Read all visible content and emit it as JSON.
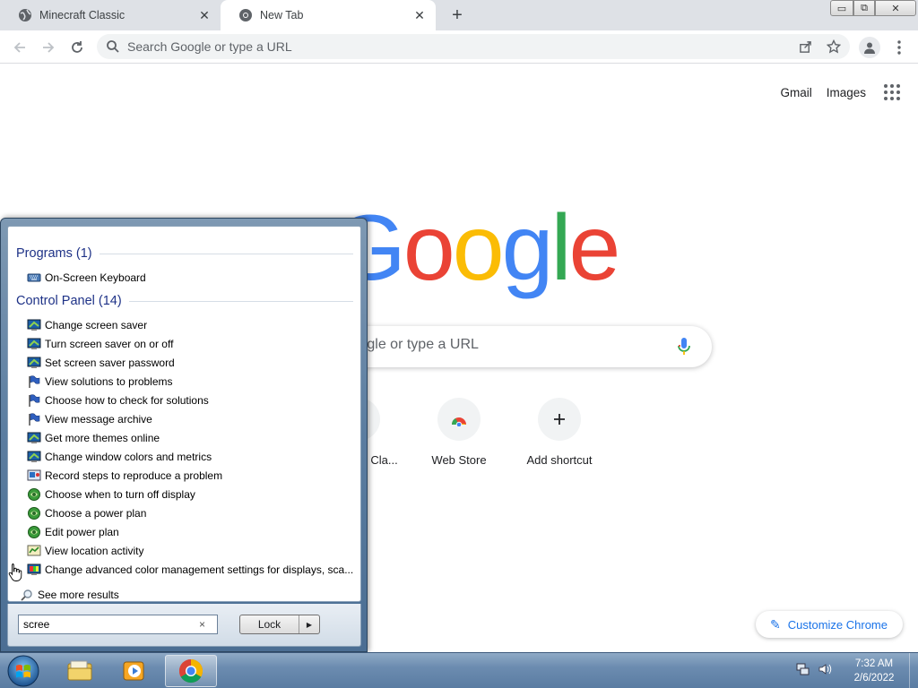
{
  "browser": {
    "tabs": [
      {
        "title": "Minecraft Classic",
        "close": "✕"
      },
      {
        "title": "New Tab",
        "close": "✕"
      }
    ],
    "new_tab": "+",
    "window_controls": {
      "minimize": "▭",
      "maximize": "⧉",
      "close": "✕"
    },
    "omnibox_placeholder": "Search Google or type a URL"
  },
  "ntp": {
    "links": {
      "gmail": "Gmail",
      "images": "Images"
    },
    "logo_letters": [
      "G",
      "o",
      "o",
      "g",
      "l",
      "e"
    ],
    "logo_colors": [
      "#4285f4",
      "#ea4335",
      "#fbbc05",
      "#4285f4",
      "#34a853",
      "#ea4335"
    ],
    "search_placeholder": "Search Google or type a URL",
    "shortcuts": [
      {
        "label": "Minecraft Cla..."
      },
      {
        "label": "Web Store"
      },
      {
        "label": "Add shortcut"
      }
    ],
    "customize_label": "Customize Chrome"
  },
  "startmenu": {
    "groups": [
      {
        "title": "Programs (1)",
        "items": [
          {
            "label": "On-Screen Keyboard",
            "icon": "keyboard-icon"
          }
        ]
      },
      {
        "title": "Control Panel (14)",
        "items": [
          {
            "label": "Change screen saver",
            "icon": "monitor-icon"
          },
          {
            "label": "Turn screen saver on or off",
            "icon": "monitor-icon"
          },
          {
            "label": "Set screen saver password",
            "icon": "monitor-icon"
          },
          {
            "label": "View solutions to problems",
            "icon": "flag-icon"
          },
          {
            "label": "Choose how to check for solutions",
            "icon": "flag-icon"
          },
          {
            "label": "View message archive",
            "icon": "flag-icon"
          },
          {
            "label": "Get more themes online",
            "icon": "monitor-icon"
          },
          {
            "label": "Change window colors and metrics",
            "icon": "monitor-icon"
          },
          {
            "label": "Record steps to reproduce a problem",
            "icon": "recorder-icon"
          },
          {
            "label": "Choose when to turn off display",
            "icon": "power-icon"
          },
          {
            "label": "Choose a power plan",
            "icon": "power-icon"
          },
          {
            "label": "Edit power plan",
            "icon": "power-icon"
          },
          {
            "label": "View location activity",
            "icon": "location-icon"
          },
          {
            "label": "Change advanced color management settings for displays, sca...",
            "icon": "color-icon"
          }
        ]
      }
    ],
    "see_more": "See more results",
    "search_value": "scree",
    "clear": "×",
    "lock_label": "Lock",
    "lock_arrow": "▶"
  },
  "taskbar": {
    "time": "7:32 AM",
    "date": "2/6/2022"
  }
}
